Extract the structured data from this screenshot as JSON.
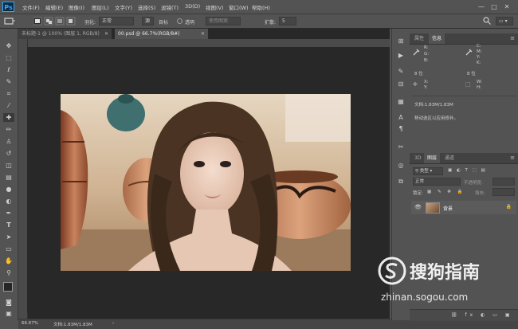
{
  "app": {
    "logo": "Ps"
  },
  "menu": [
    "文件(F)",
    "编辑(E)",
    "图像(I)",
    "图层(L)",
    "文字(Y)",
    "选择(S)",
    "滤镜(T)",
    "3D(D)",
    "视图(V)",
    "窗口(W)",
    "帮助(H)"
  ],
  "window_controls": {
    "minimize": "—",
    "maximize": "□",
    "close": "✕"
  },
  "options_bar": {
    "feather_label": "羽化:",
    "mode_value": "正常",
    "source_label": "源",
    "target_label": "目标",
    "transparent_label": "透明",
    "use_pattern_label": "使用图案",
    "diffusion_label": "扩散:",
    "diffusion_value": "5"
  },
  "tabs": [
    {
      "label": "未标题-1 @ 100% (图层 1, RGB/8)",
      "active": false
    },
    {
      "label": "00.psd @ 66.7%(RGB/8#)",
      "active": true
    }
  ],
  "panels": {
    "top_tabs": [
      "属性",
      "信息"
    ],
    "info": {
      "rgb_labels": [
        "R:",
        "G:",
        "B:"
      ],
      "cmyk_labels": [
        "C:",
        "M:",
        "Y:",
        "K:"
      ],
      "bits_left": "8 位",
      "bits_right": "8 位",
      "xy_labels": [
        "X:",
        "Y:"
      ],
      "wh_labels": [
        "W:",
        "H:"
      ],
      "doc_size": "文档:1.83M/1.83M",
      "hint": "移动选区以应用修补。"
    },
    "bottom_tabs": [
      "3D",
      "图层",
      "通道"
    ],
    "layers": {
      "filter_kind": "类型",
      "blend_mode": "正常",
      "opacity_label": "不透明度:",
      "lock_label": "锁定:",
      "fill_label": "填充:",
      "layer_name": "背景"
    }
  },
  "status": {
    "zoom": "66.67%",
    "doc": "文档:1.83M/1.83M"
  },
  "watermark": {
    "brand": "搜狗指南",
    "url": "zhinan.sogou.com"
  },
  "colors": {
    "accent": "#31a8ff",
    "bg": "#535353",
    "workspace": "#282828"
  }
}
